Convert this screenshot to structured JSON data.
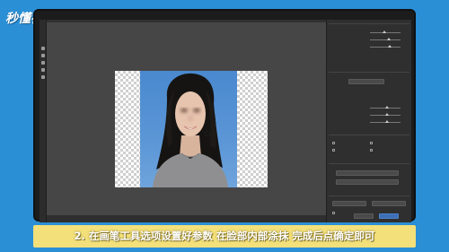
{
  "watermark": {
    "text": "秒懂视频"
  },
  "editor": {
    "status_text": "",
    "right_panel": {
      "rows": [
        {
          "label": ""
        },
        {
          "label": ""
        },
        {
          "label": ""
        },
        {
          "label": ""
        },
        {
          "label": ""
        },
        {
          "label": ""
        }
      ],
      "buttons": {
        "cancel_label": "",
        "ok_label": ""
      }
    }
  },
  "subtitle": {
    "text": "2. 在画笔工具选项设置好参数 在脸部内部涂抹 完成后点确定即可"
  },
  "colors": {
    "page_background": "#2b8fd6",
    "subtitle_background": "#f3e07a",
    "photo_background": "#4a89cf",
    "accent_button": "#3d6fb6"
  }
}
